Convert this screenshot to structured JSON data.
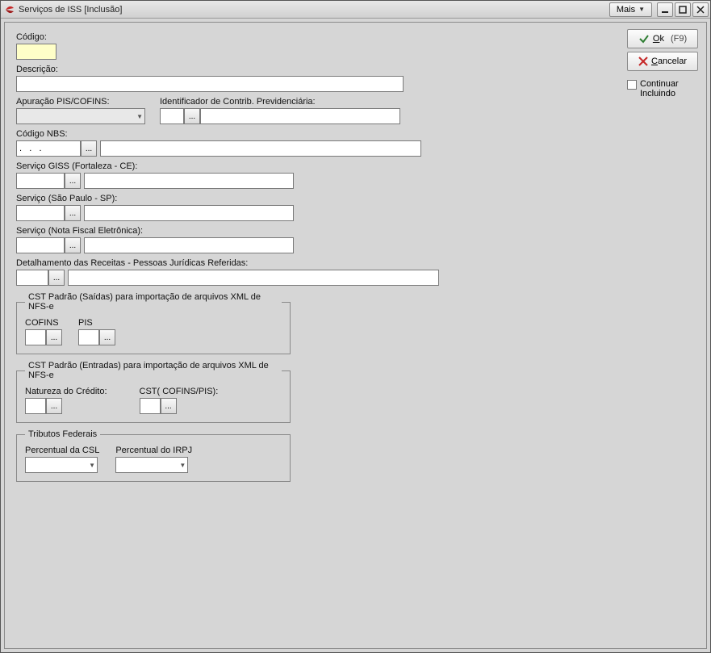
{
  "window": {
    "title": "Serviços de ISS [Inclusão]"
  },
  "titlebar_buttons": {
    "mais": "Mais"
  },
  "actions": {
    "ok_underlined": "O",
    "ok_rest": "k",
    "ok_hint": "(F9)",
    "cancel_underlined": "C",
    "cancel_rest": "ancelar",
    "continuar": "Continuar",
    "incluindo": "Incluindo"
  },
  "labels": {
    "codigo": "Código:",
    "descricao": "Descrição:",
    "apuracao": "Apuração PIS/COFINS:",
    "id_contrib_prev": "Identificador de Contrib. Previdenciária:",
    "codigo_nbs": "Código NBS:",
    "nbs_mask": ".   .   .",
    "servico_giss": "Serviço GISS (Fortaleza - CE):",
    "servico_sp": "Serviço (São Paulo - SP):",
    "servico_nfe": "Serviço (Nota Fiscal Eletrônica):",
    "detalhamento": "Detalhamento das Receitas - Pessoas Jurídicas Referidas:",
    "cst_saidas_legend": "CST Padrão (Saídas) para importação de arquivos XML de NFS-e",
    "cofins": "COFINS",
    "pis": "PIS",
    "cst_entradas_legend": "CST Padrão (Entradas) para importação de arquivos XML de NFS-e",
    "natureza_credito": "Natureza do Crédito:",
    "cst_cofins_pis": "CST( COFINS/PIS):",
    "tributos_legend": "Tributos Federais",
    "percentual_csl": "Percentual da CSL",
    "percentual_irpj": "Percentual do IRPJ"
  },
  "lookup_dots": "..."
}
